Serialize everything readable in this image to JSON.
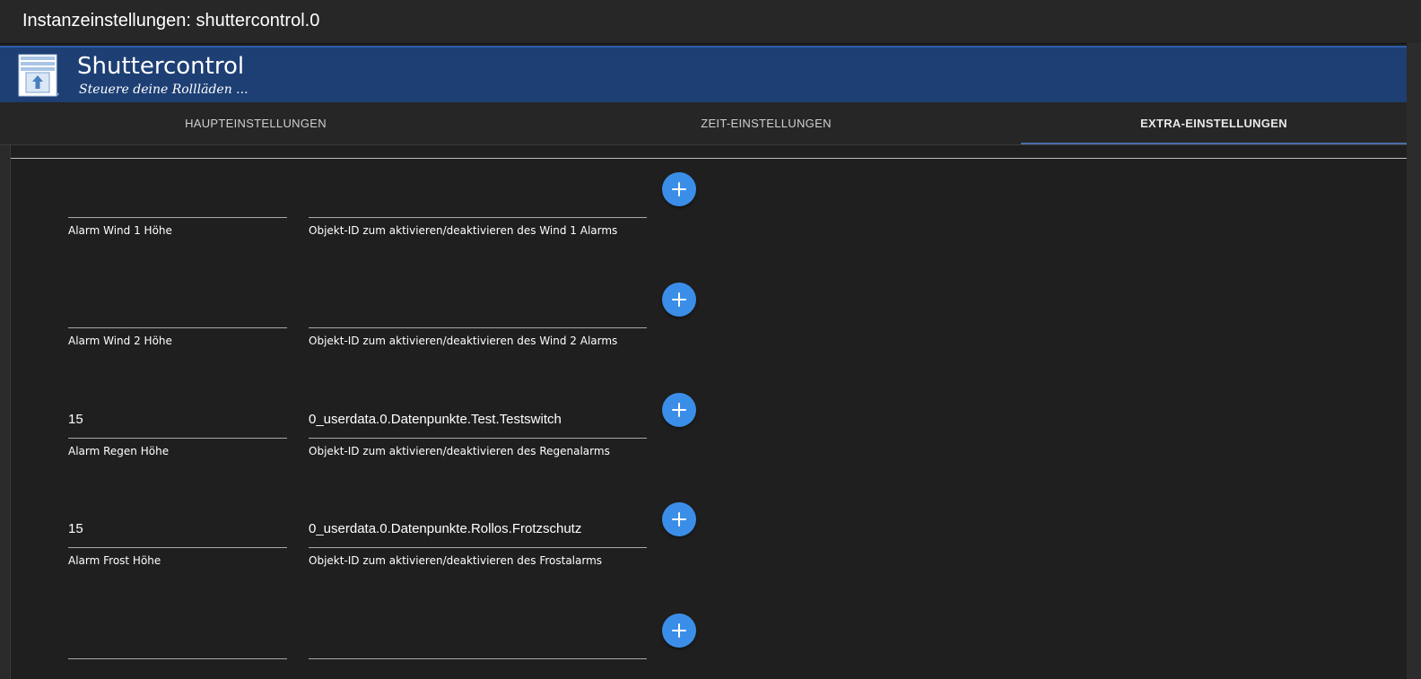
{
  "window": {
    "title": "Instanzeinstellungen: shuttercontrol.0"
  },
  "banner": {
    "title": "Shuttercontrol",
    "subtitle": "Steuere deine Rollläden ..."
  },
  "tabs": [
    {
      "label": "HAUPTEINSTELLUNGEN",
      "active": false
    },
    {
      "label": "ZEIT-EINSTELLUNGEN",
      "active": false
    },
    {
      "label": "EXTRA-EINSTELLUNGEN",
      "active": true
    }
  ],
  "rows": [
    {
      "height_value": "",
      "height_label": "Alarm Wind 1 Höhe",
      "object_value": "",
      "object_label": "Objekt-ID zum aktivieren/deaktivieren des Wind 1 Alarms"
    },
    {
      "height_value": "",
      "height_label": "Alarm Wind 2 Höhe",
      "object_value": "",
      "object_label": "Objekt-ID zum aktivieren/deaktivieren des Wind 2 Alarms"
    },
    {
      "height_value": "15",
      "height_label": "Alarm Regen Höhe",
      "object_value": "0_userdata.0.Datenpunkte.Test.Testswitch",
      "object_label": "Objekt-ID zum aktivieren/deaktivieren des Regenalarms"
    },
    {
      "height_value": "15",
      "height_label": "Alarm Frost Höhe",
      "object_value": "0_userdata.0.Datenpunkte.Rollos.Frotzschutz",
      "object_label": "Objekt-ID zum aktivieren/deaktivieren des Frostalarms"
    },
    {
      "height_value": "",
      "height_label": "",
      "object_value": "",
      "object_label": ""
    }
  ],
  "icons": {
    "add": "plus-icon",
    "logo": "shutter-logo-icon"
  },
  "colors": {
    "accent": "#3b8ee8",
    "banner": "#1d3f74",
    "background": "#1f1f1f"
  }
}
